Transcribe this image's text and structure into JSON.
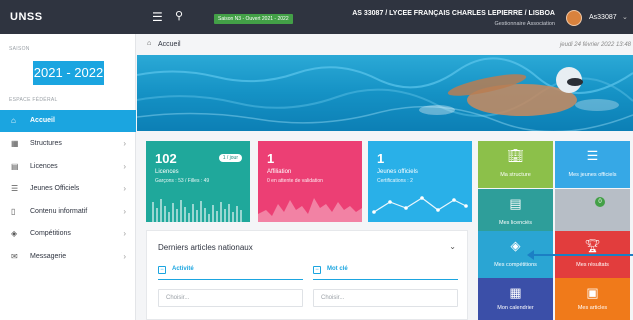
{
  "app": {
    "logo": "UNSS"
  },
  "topbar": {
    "season_badge": "Saison N3 - Ouvert 2021 - 2022",
    "org_name": "AS 33087 / LYCEE FRANÇAIS CHARLES LEPIERRE / LISBOA",
    "org_role": "Gestionnaire Association",
    "user_name": "As33087"
  },
  "sidebar": {
    "season_label": "SAISON",
    "season_value": "2021 - 2022",
    "space_label": "ESPACE FÉDÉRAL",
    "items": [
      {
        "label": "Accueil",
        "icon": "home-icon",
        "active": true
      },
      {
        "label": "Structures",
        "icon": "building-icon"
      },
      {
        "label": "Licences",
        "icon": "id-card-icon"
      },
      {
        "label": "Jeunes Officiels",
        "icon": "stack-icon"
      },
      {
        "label": "Contenu informatif",
        "icon": "document-icon"
      },
      {
        "label": "Compétitions",
        "icon": "layers-icon"
      },
      {
        "label": "Messagerie",
        "icon": "mail-icon"
      }
    ]
  },
  "breadcrumb": {
    "label": "Accueil"
  },
  "date": "jeudi 24 février 2022 13:48",
  "cards": [
    {
      "value": "102",
      "title": "Licences",
      "sub": "Garçons : 53 / Filles : 49",
      "tag": "1 / jour",
      "color": "#1fa89b"
    },
    {
      "value": "1",
      "title": "Affiliation",
      "sub": "0 en attente de validation",
      "color": "#ec3f74"
    },
    {
      "value": "1",
      "title": "Jeunes officiels",
      "sub": "Certifications : 2",
      "color": "#29b0e8"
    }
  ],
  "articles": {
    "title": "Derniers articles nationaux",
    "filter_activity": "Activité",
    "filter_keyword": "Mot clé",
    "select_placeholder": "Choisir..."
  },
  "tiles": [
    {
      "label": "Ma structure",
      "icon": "building-icon",
      "color": "#8cc04a"
    },
    {
      "label": "Mes jeunes officiels",
      "icon": "database-icon",
      "color": "#36a8e6"
    },
    {
      "label": "Mes licenciés",
      "icon": "book-icon",
      "color": "#2e9e9a"
    },
    {
      "label": "",
      "icon": "blank-icon",
      "color": "#b7bec6",
      "notif": "0"
    },
    {
      "label": "Mes compétitions",
      "icon": "layers-icon",
      "color": "#2aa5d3"
    },
    {
      "label": "Mes résultats",
      "icon": "trophy-icon",
      "color": "#e23d3d"
    },
    {
      "label": "Mon calendrier",
      "icon": "calendar-icon",
      "color": "#3b4fa8"
    },
    {
      "label": "Mes articles",
      "icon": "newspaper-icon",
      "color": "#f07a1a"
    }
  ]
}
